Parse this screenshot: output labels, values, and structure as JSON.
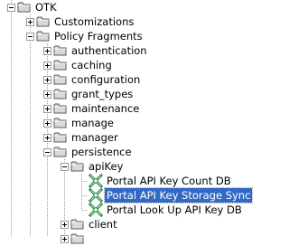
{
  "tree": {
    "root": {
      "label": "OTK"
    },
    "customizations": {
      "label": "Customizations"
    },
    "policy_fragments": {
      "label": "Policy Fragments"
    },
    "authentication": {
      "label": "authentication"
    },
    "caching": {
      "label": "caching"
    },
    "configuration": {
      "label": "configuration"
    },
    "grant_types": {
      "label": "grant_types"
    },
    "maintenance": {
      "label": "maintenance"
    },
    "manage": {
      "label": "manage"
    },
    "manager": {
      "label": "manager"
    },
    "persistence": {
      "label": "persistence"
    },
    "apikey": {
      "label": "apiKey"
    },
    "policy_count": {
      "label": "Portal API Key Count DB"
    },
    "policy_storage_sync": {
      "label": "Portal API Key Storage Sync"
    },
    "policy_lookup": {
      "label": "Portal Look Up API Key DB"
    },
    "client": {
      "label": "client"
    }
  },
  "colors": {
    "selection_bg": "#316ac5",
    "selection_fg": "#ffffff",
    "folder_fill": "#d9d9d9",
    "folder_stroke": "#5a5a5a",
    "policy_green": "#1f8a3c"
  },
  "icons": {
    "folder": "folder-icon",
    "policy": "policy-icon",
    "expand": "plus-box-icon",
    "collapse": "minus-box-icon"
  }
}
